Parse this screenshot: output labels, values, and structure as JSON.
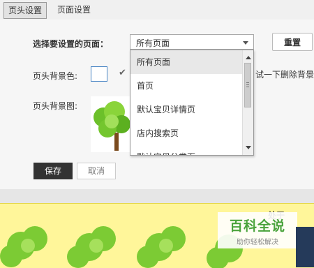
{
  "tabs": [
    {
      "label": "页头设置",
      "active": true
    },
    {
      "label": "页面设置",
      "active": false
    }
  ],
  "form": {
    "select_page_label": "选择要设置的页面：",
    "select_value": "所有页面",
    "reset_label": "重置",
    "bg_color_label": "页头背景色:",
    "bg_image_label": "页头背景图:",
    "hint_text": "试一下删除背景"
  },
  "dropdown": {
    "options": [
      "所有页面",
      "首页",
      "默认宝贝详情页",
      "店内搜索页",
      "默认宝贝分类页"
    ],
    "selected_index": 0
  },
  "actions": {
    "save_label": "保存",
    "cancel_label": "取消"
  },
  "banner": {
    "text": "处于"
  },
  "watermark": {
    "title": "百科全说",
    "subtitle": "助你轻松解决"
  },
  "colors": {
    "accent_yellow": "#fff69a",
    "save_bg": "#333333",
    "watermark_green": "#4aa33c"
  }
}
